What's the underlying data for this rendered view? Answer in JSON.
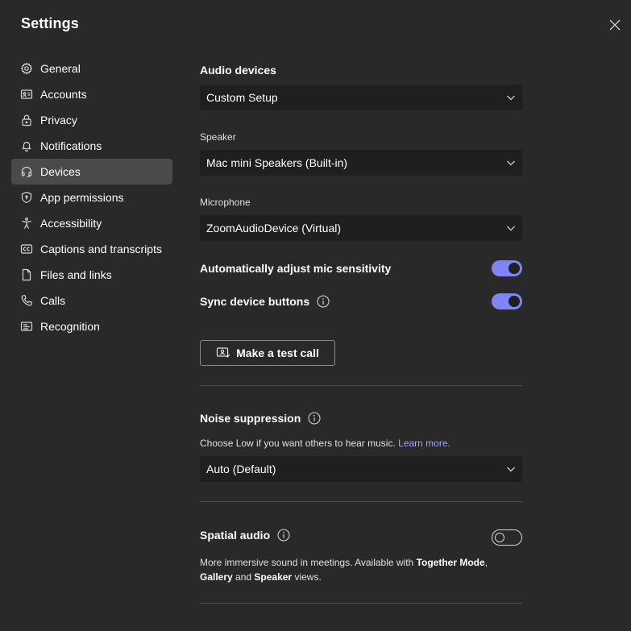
{
  "window": {
    "title": "Settings"
  },
  "sidebar": {
    "items": [
      {
        "label": "General",
        "icon": "gear-icon",
        "active": false
      },
      {
        "label": "Accounts",
        "icon": "id-card-icon",
        "active": false
      },
      {
        "label": "Privacy",
        "icon": "lock-icon",
        "active": false
      },
      {
        "label": "Notifications",
        "icon": "bell-icon",
        "active": false
      },
      {
        "label": "Devices",
        "icon": "headset-icon",
        "active": true
      },
      {
        "label": "App permissions",
        "icon": "shield-icon",
        "active": false
      },
      {
        "label": "Accessibility",
        "icon": "accessibility-icon",
        "active": false
      },
      {
        "label": "Captions and transcripts",
        "icon": "captions-icon",
        "active": false
      },
      {
        "label": "Files and links",
        "icon": "file-icon",
        "active": false
      },
      {
        "label": "Calls",
        "icon": "phone-icon",
        "active": false
      },
      {
        "label": "Recognition",
        "icon": "recognition-icon",
        "active": false
      }
    ]
  },
  "audio": {
    "title": "Audio devices",
    "device_value": "Custom Setup",
    "speaker_label": "Speaker",
    "speaker_value": "Mac mini Speakers (Built-in)",
    "microphone_label": "Microphone",
    "microphone_value": "ZoomAudioDevice (Virtual)",
    "auto_adjust_label": "Automatically adjust mic sensitivity",
    "auto_adjust_on": true,
    "sync_label": "Sync device buttons",
    "sync_on": true,
    "test_call_label": "Make a test call"
  },
  "noise": {
    "title": "Noise suppression",
    "helper_text": "Choose Low if you want others to hear music.",
    "learn_more": "Learn more.",
    "value": "Auto (Default)"
  },
  "spatial": {
    "title": "Spatial audio",
    "on": false,
    "desc_part1": "More immersive sound in meetings. Available with ",
    "together_mode": "Together Mode",
    "comma": ",",
    "gallery": "Gallery",
    "and": " and ",
    "speaker": "Speaker",
    "views": " views."
  },
  "colors": {
    "background": "#292929",
    "accent": "#7f85f5",
    "link": "#9ea2ff",
    "active_item": "#4a4a4a",
    "select_bg": "#1f1f1f"
  }
}
